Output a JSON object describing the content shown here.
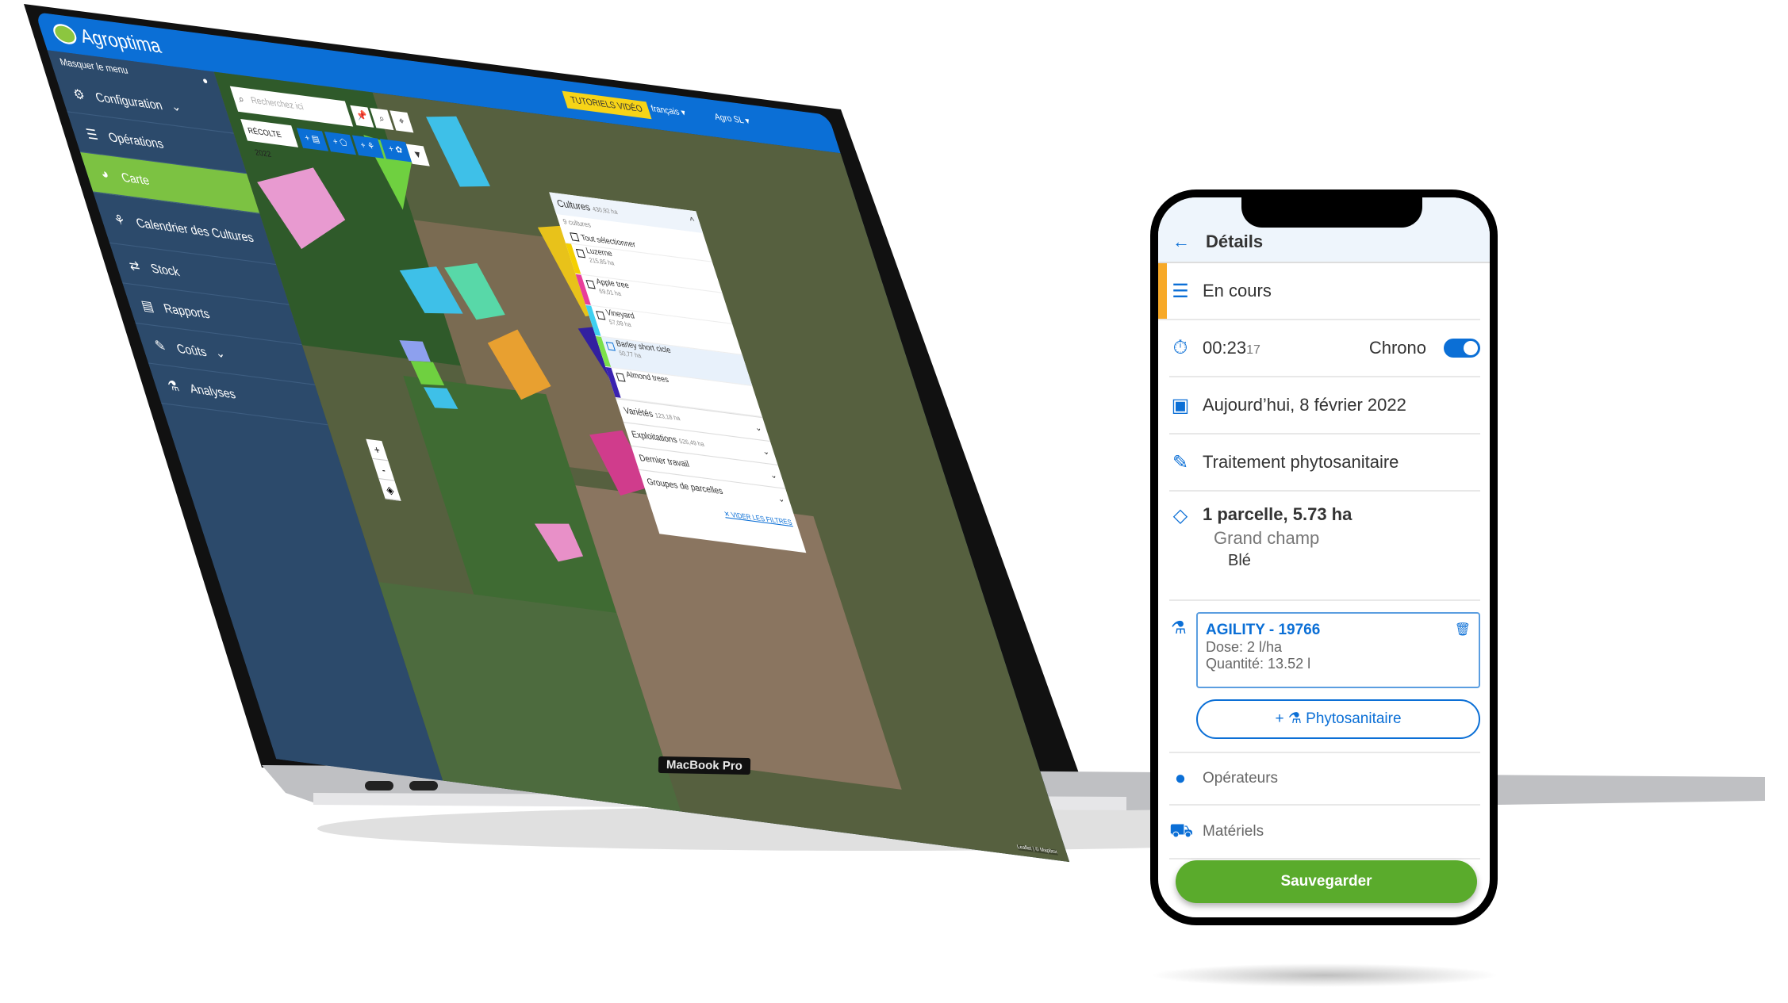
{
  "laptop": {
    "brand": "MacBook Pro",
    "app": {
      "logo": "Agroptima",
      "topbar": {
        "tutorials": "TUTORIELS VIDÉO",
        "language": "français ▾",
        "account": "Agro SL ▾"
      },
      "sidebar": {
        "hide_menu": "Masquer le menu",
        "items": [
          {
            "label": "Configuration",
            "icon": "gear-icon",
            "chevron": "⌄"
          },
          {
            "label": "Opérations",
            "icon": "list-icon"
          },
          {
            "label": "Carte",
            "icon": "globe-icon",
            "active": true
          },
          {
            "label": "Calendrier des Cultures",
            "icon": "wheat-icon"
          },
          {
            "label": "Stock",
            "icon": "transfer-icon"
          },
          {
            "label": "Rapports",
            "icon": "report-icon"
          },
          {
            "label": "Coûts",
            "icon": "costs-icon",
            "chevron": "⌄"
          },
          {
            "label": "Analyses",
            "icon": "flask-icon"
          }
        ]
      },
      "map": {
        "search_placeholder": "Recherchez ici",
        "season": "RÉCOLTE 2022",
        "add_buttons": [
          "+ ▤",
          "+ ⬠",
          "+ ⚘",
          "+ ✿"
        ],
        "zoom_in": "+",
        "zoom_out": "-",
        "attribution": "Leaflet | © Mapbox"
      },
      "filters": {
        "cultures": {
          "label": "Cultures",
          "area": "430,92 ha",
          "count": "9 cultures",
          "select_all": "Tout sélectionner",
          "items": [
            {
              "name": "Luzerne",
              "area": "215,85 ha",
              "color": "#f4d000"
            },
            {
              "name": "Apple tree",
              "area": "69,01 ha",
              "color": "#e83e9a"
            },
            {
              "name": "Vineyard",
              "area": "57,09 ha",
              "color": "#3fd0f0"
            },
            {
              "name": "Barley short cicle",
              "area": "50,77 ha",
              "color": "#7ce04a"
            },
            {
              "name": "Almond trees",
              "area": "",
              "color": "#3a22b0"
            }
          ]
        },
        "groups": [
          {
            "label": "Variétés",
            "area": "123,18 ha"
          },
          {
            "label": "Exploitations",
            "area": "526,49 ha"
          },
          {
            "label": "Dernier travail",
            "area": ""
          },
          {
            "label": "Groupes de parcelles",
            "area": ""
          }
        ],
        "clear": "✕ VIDER LES FILTRES"
      }
    }
  },
  "phone": {
    "header": {
      "title": "Détails"
    },
    "status": "En cours",
    "timer": {
      "main": "00:23",
      "seconds": "17",
      "chrono_label": "Chrono",
      "chrono_on": true
    },
    "date": "Aujourd’hui, 8 février 2022",
    "job_type": "Traitement phytosanitaire",
    "plots": {
      "summary": "1 parcelle, 5.73 ha",
      "plot": "Grand champ",
      "crop": "Blé"
    },
    "product": {
      "name": "AGILITY - 19766",
      "dose": "Dose: 2 l/ha",
      "quantity": "Quantité: 13.52 l"
    },
    "add_product": "+ ⚗ Phytosanitaire",
    "operators": "Opérateurs",
    "machinery": "Matériels",
    "save": "Sauvegarder"
  },
  "colors": {
    "primary": "#0b6fd6",
    "accent_green": "#5aab2c",
    "status_orange": "#f7a928",
    "sidebar": "#2c4a6b"
  }
}
